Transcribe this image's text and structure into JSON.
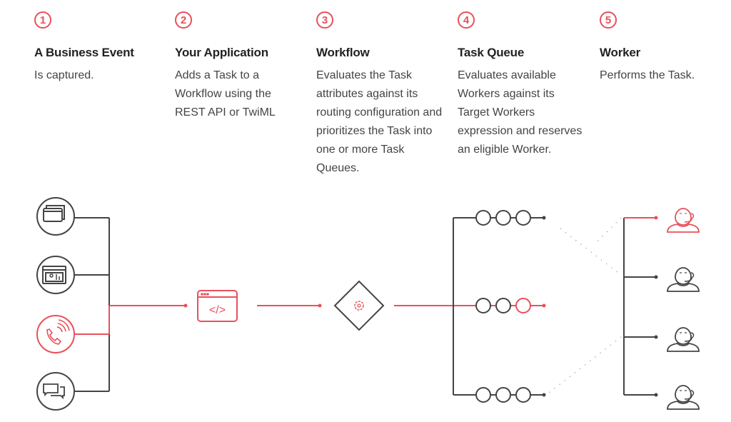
{
  "steps": [
    {
      "number": "1",
      "title": "A Business Event",
      "description": "Is captured."
    },
    {
      "number": "2",
      "title": "Your Application",
      "description": "Adds a Task to a Workflow using the REST API or TwiML"
    },
    {
      "number": "3",
      "title": "Workflow",
      "description": "Evaluates the Task attributes against its routing configuration and prioritizes the Task into one or more Task Queues."
    },
    {
      "number": "4",
      "title": "Task Queue",
      "description": "Evaluates available Workers against its Target Workers expression and reserves an eligible Worker."
    },
    {
      "number": "5",
      "title": "Worker",
      "description": "Performs the Task."
    }
  ],
  "diagram": {
    "channels": [
      "chat-icon",
      "video-profile-icon",
      "phone-icon",
      "messaging-icon"
    ],
    "active_channel": 2,
    "application_icon": "code-window-icon",
    "workflow_icon": "gear-diamond-icon",
    "queues": 3,
    "active_queue": 1,
    "workers": 4,
    "active_worker": 0,
    "code_label": "</>"
  },
  "colors": {
    "accent": "#e8505b",
    "line": "#444444"
  }
}
